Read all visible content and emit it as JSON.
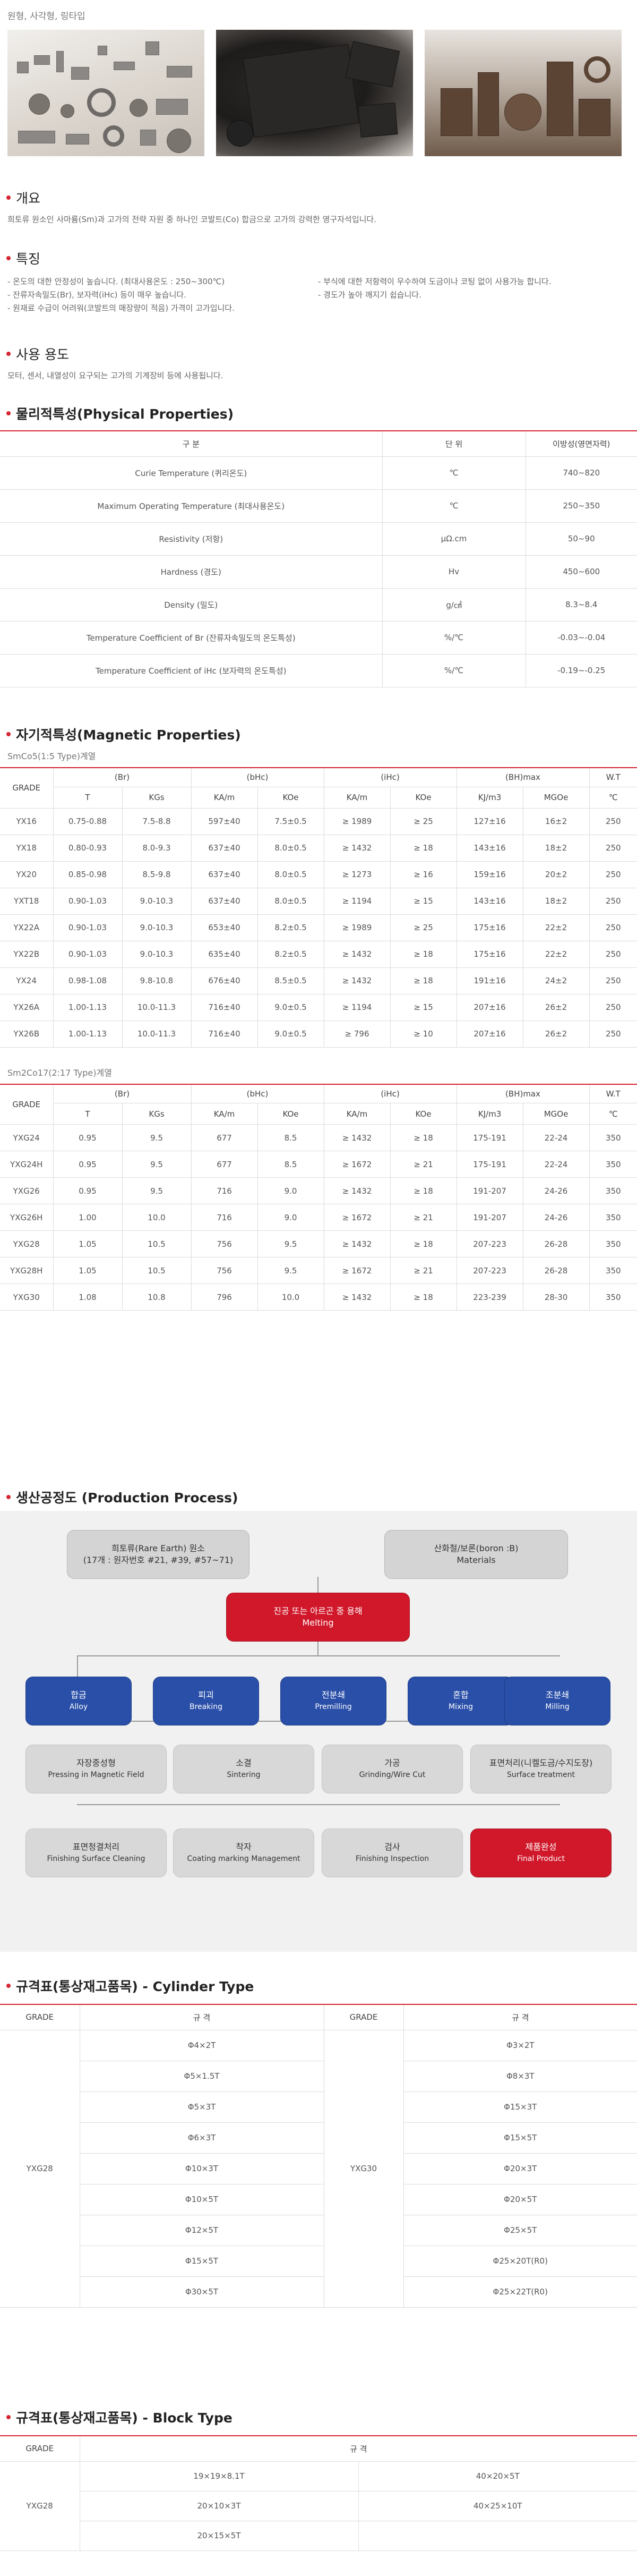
{
  "shapes_caption": "원형, 사각형, 링타입",
  "overview": {
    "title": "개요",
    "text": "희토류 원소인 사마륨(Sm)과 고가의 전략 자원 중 하나인 코발트(Co) 합금으로 고가의 강력한 영구자석입니다."
  },
  "features": {
    "title": "특징",
    "left": [
      "- 온도의 대한 안정성이 높습니다. (최대사용온도 : 250~300℃)",
      "- 잔류자속밀도(Br), 보자력(iHc) 등이 매우 높습니다.",
      "- 원재료 수급이 어려워(코발트의 매장량이 적음) 가격이 고가입니다."
    ],
    "right": [
      "- 부식에 대한 저항력이 우수하여 도금이나 코팅 없이 사용가능 합니다.",
      "- 경도가 높아 깨지기 쉽습니다."
    ]
  },
  "usage": {
    "title": "사용 용도",
    "text": "모터, 센서, 내열성이 요구되는 고가의 기계장비 등에 사용됩니다."
  },
  "physical": {
    "title": "물리적특성(Physical Properties)",
    "headers": [
      "구 분",
      "단 위",
      "이방성(영면자력)"
    ],
    "rows": [
      [
        "Curie Temperature (퀴리온도)",
        "℃",
        "740~820"
      ],
      [
        "Maximum Operating Temperature (최대사용온도)",
        "℃",
        "250~350"
      ],
      [
        "Resistivity (저항)",
        "μΩ.cm",
        "50~90"
      ],
      [
        "Hardness (경도)",
        "Hv",
        "450~600"
      ],
      [
        "Density (밀도)",
        "g/㎤",
        "8.3~8.4"
      ],
      [
        "Temperature Coefficient of Br (잔류자속밀도의 온도특성)",
        "%/℃",
        "-0.03~-0.04"
      ],
      [
        "Temperature Coefficient of iHc (보자력의 온도특성)",
        "%/℃",
        "-0.19~-0.25"
      ]
    ]
  },
  "magnetic": {
    "title": "자기적특성(Magnetic Properties)",
    "group_headers": [
      "GRADE",
      "(Br)",
      "(bHc)",
      "(iHc)",
      "(BH)max",
      "W.T"
    ],
    "t1": {
      "caption": "SmCo5(1:5 Type)계열",
      "units": [
        "T",
        "KGs",
        "KA/m",
        "KOe",
        "KA/m",
        "KOe",
        "KJ/m3",
        "MGOe",
        "℃"
      ],
      "rows": [
        [
          "YX16",
          "0.75-0.88",
          "7.5-8.8",
          "597±40",
          "7.5±0.5",
          "≥ 1989",
          "≥ 25",
          "127±16",
          "16±2",
          "250"
        ],
        [
          "YX18",
          "0.80-0.93",
          "8.0-9.3",
          "637±40",
          "8.0±0.5",
          "≥ 1432",
          "≥ 18",
          "143±16",
          "18±2",
          "250"
        ],
        [
          "YX20",
          "0.85-0.98",
          "8.5-9.8",
          "637±40",
          "8.0±0.5",
          "≥ 1273",
          "≥ 16",
          "159±16",
          "20±2",
          "250"
        ],
        [
          "YXT18",
          "0.90-1.03",
          "9.0-10.3",
          "637±40",
          "8.0±0.5",
          "≥ 1194",
          "≥ 15",
          "143±16",
          "18±2",
          "250"
        ],
        [
          "YX22A",
          "0.90-1.03",
          "9.0-10.3",
          "653±40",
          "8.2±0.5",
          "≥ 1989",
          "≥ 25",
          "175±16",
          "22±2",
          "250"
        ],
        [
          "YX22B",
          "0.90-1.03",
          "9.0-10.3",
          "635±40",
          "8.2±0.5",
          "≥ 1432",
          "≥ 18",
          "175±16",
          "22±2",
          "250"
        ],
        [
          "YX24",
          "0.98-1.08",
          "9.8-10.8",
          "676±40",
          "8.5±0.5",
          "≥ 1432",
          "≥ 18",
          "191±16",
          "24±2",
          "250"
        ],
        [
          "YX26A",
          "1.00-1.13",
          "10.0-11.3",
          "716±40",
          "9.0±0.5",
          "≥ 1194",
          "≥ 15",
          "207±16",
          "26±2",
          "250"
        ],
        [
          "YX26B",
          "1.00-1.13",
          "10.0-11.3",
          "716±40",
          "9.0±0.5",
          "≥ 796",
          "≥ 10",
          "207±16",
          "26±2",
          "250"
        ]
      ]
    },
    "t2": {
      "caption": "Sm2Co17(2:17 Type)계열",
      "units": [
        "T",
        "KGs",
        "KA/m",
        "KOe",
        "KA/m",
        "KOe",
        "KJ/m3",
        "MGOe",
        "℃"
      ],
      "rows": [
        [
          "YXG24",
          "0.95",
          "9.5",
          "677",
          "8.5",
          "≥ 1432",
          "≥ 18",
          "175-191",
          "22-24",
          "350"
        ],
        [
          "YXG24H",
          "0.95",
          "9.5",
          "677",
          "8.5",
          "≥ 1672",
          "≥ 21",
          "175-191",
          "22-24",
          "350"
        ],
        [
          "YXG26",
          "0.95",
          "9.5",
          "716",
          "9.0",
          "≥ 1432",
          "≥ 18",
          "191-207",
          "24-26",
          "350"
        ],
        [
          "YXG26H",
          "1.00",
          "10.0",
          "716",
          "9.0",
          "≥ 1672",
          "≥ 21",
          "191-207",
          "24-26",
          "350"
        ],
        [
          "YXG28",
          "1.05",
          "10.5",
          "756",
          "9.5",
          "≥ 1432",
          "≥ 18",
          "207-223",
          "26-28",
          "350"
        ],
        [
          "YXG28H",
          "1.05",
          "10.5",
          "756",
          "9.5",
          "≥ 1672",
          "≥ 21",
          "207-223",
          "26-28",
          "350"
        ],
        [
          "YXG30",
          "1.08",
          "10.8",
          "796",
          "10.0",
          "≥ 1432",
          "≥ 18",
          "223-239",
          "28-30",
          "350"
        ]
      ]
    }
  },
  "process": {
    "title": "생산공정도 (Production Process)",
    "raw1": {
      "kr": "희토류(Rare Earth) 원소",
      "kr2": "(17개 : 원자번호 #21, #39, #57~71)"
    },
    "raw2": {
      "kr": "산화철/보론(boron :B)",
      "en": "Materials"
    },
    "melting": {
      "kr": "진공 또는 아르곤 중 용해",
      "en": "Melting"
    },
    "row1": [
      {
        "kr": "합금",
        "en": "Alloy"
      },
      {
        "kr": "피괴",
        "en": "Breaking"
      },
      {
        "kr": "전분쇄",
        "en": "Premilling"
      },
      {
        "kr": "혼합",
        "en": "Mixing"
      },
      {
        "kr": "조분쇄",
        "en": "Milling"
      }
    ],
    "row2": [
      {
        "kr": "자장중성형",
        "en": "Pressing in Magnetic Field"
      },
      {
        "kr": "소결",
        "en": "Sintering"
      },
      {
        "kr": "가공",
        "en": "Grinding/Wire Cut"
      },
      {
        "kr": "표면처리(니켈도금/수지도장)",
        "en": "Surface treatment"
      }
    ],
    "row3": [
      {
        "kr": "표면청결처리",
        "en": "Finishing Surface Cleaning"
      },
      {
        "kr": "착자",
        "en": "Coating marking Management"
      },
      {
        "kr": "검사",
        "en": "Finishing Inspection"
      },
      {
        "kr": "제품완성",
        "en": "Final Product"
      }
    ]
  },
  "cylinder": {
    "title": "규격표(통상재고품목) - Cylinder Type",
    "headers": [
      "GRADE",
      "규 격",
      "GRADE",
      "규 격"
    ],
    "grade_left": "YXG28",
    "grade_right": "YXG30",
    "rows": [
      [
        "Φ4×2T",
        "Φ3×2T"
      ],
      [
        "Φ5×1.5T",
        "Φ8×3T"
      ],
      [
        "Φ5×3T",
        "Φ15×3T"
      ],
      [
        "Φ6×3T",
        "Φ15×5T"
      ],
      [
        "Φ10×3T",
        "Φ20×3T"
      ],
      [
        "Φ10×5T",
        "Φ20×5T"
      ],
      [
        "Φ12×5T",
        "Φ25×5T"
      ],
      [
        "Φ15×5T",
        "Φ25×20T(R0)"
      ],
      [
        "Φ30×5T",
        "Φ25×22T(R0)"
      ]
    ]
  },
  "block": {
    "title": "규격표(통상재고품목) - Block Type",
    "headers": [
      "GRADE",
      "규 격"
    ],
    "grade": "YXG28",
    "rows": [
      [
        "19×19×8.1T",
        "40×20×5T"
      ],
      [
        "20×10×3T",
        "40×25×10T"
      ],
      [
        "20×15×5T",
        ""
      ]
    ]
  }
}
